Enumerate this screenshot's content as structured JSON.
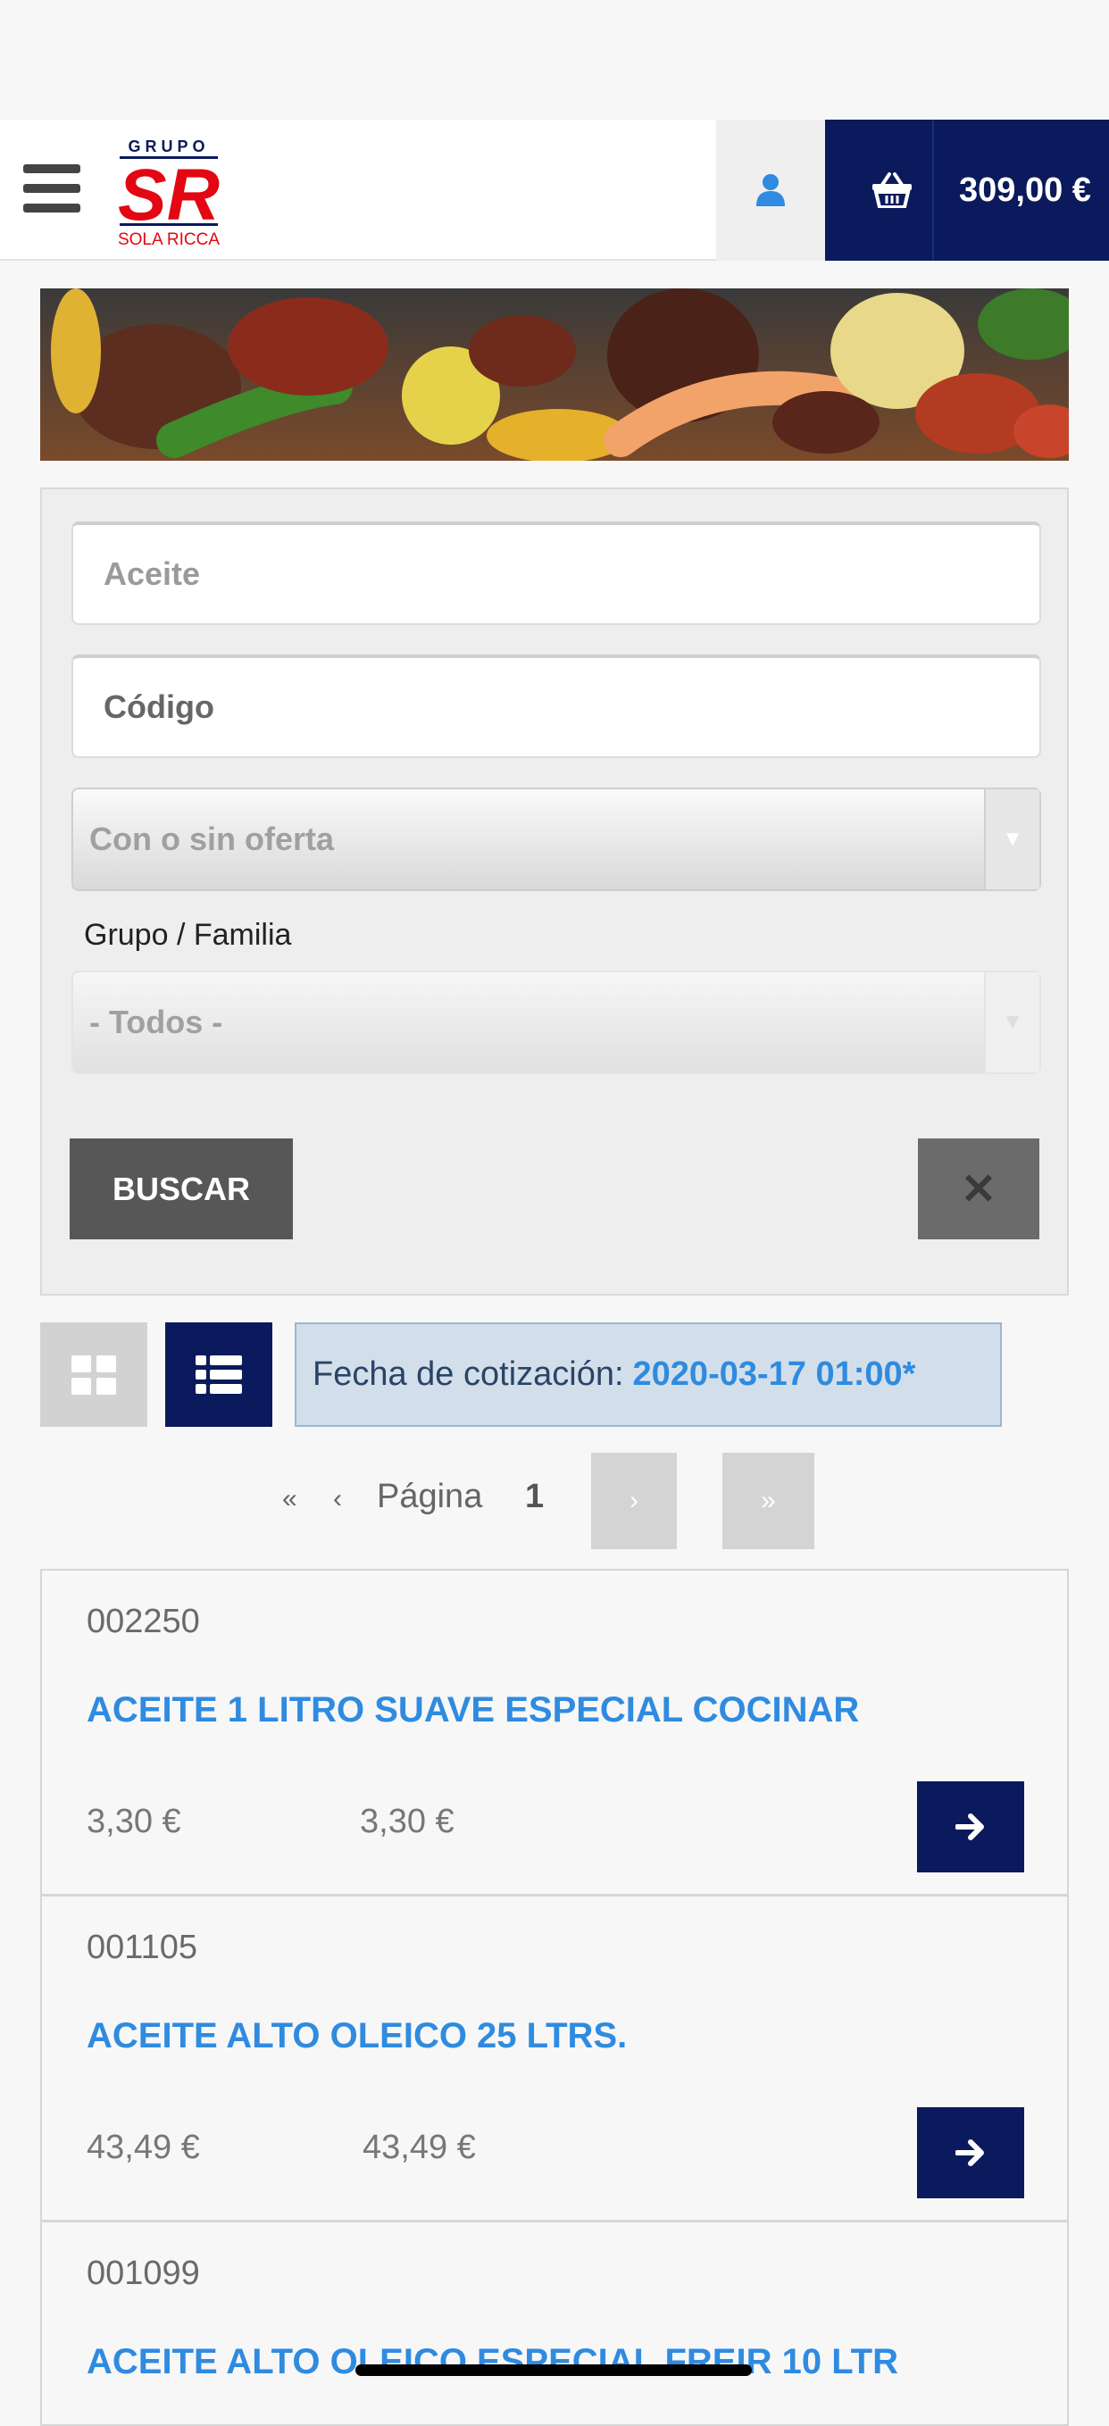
{
  "header": {
    "brand": {
      "top": "GRUPO",
      "mark": "SR",
      "bottom": "SOLA RICCA"
    },
    "cart_total": "309,00 €"
  },
  "search": {
    "query_value": "Aceite",
    "code_placeholder": "Código",
    "offer_select_value": "Con o sin oferta",
    "group_label": "Grupo / Familia",
    "group_select_value": "- Todos -",
    "search_button": "BUSCAR",
    "clear_button": "✕"
  },
  "quote": {
    "label": "Fecha de cotización:",
    "date": "2020-03-17 01:00*"
  },
  "pagination": {
    "first": "«",
    "prev": "‹",
    "label": "Página",
    "page": "1",
    "next": "›",
    "last": "»"
  },
  "products": [
    {
      "code": "002250",
      "name": "ACEITE 1 LITRO SUAVE ESPECIAL COCINAR",
      "price1": "3,30 €",
      "price2": "3,30 €"
    },
    {
      "code": "001105",
      "name": "ACEITE ALTO OLEICO 25 LTRS.",
      "price1": "43,49 €",
      "price2": "43,49 €"
    },
    {
      "code": "001099",
      "name": "ACEITE ALTO OLEICO ESPECIAL FREIR 10 LTR"
    }
  ],
  "colors": {
    "navy": "#0b1a5c",
    "link_blue": "#2f8be0",
    "brand_red": "#e30613"
  },
  "icons": [
    "menu-icon",
    "user-icon",
    "basket-icon",
    "grid-view-icon",
    "list-view-icon",
    "arrow-right-icon"
  ]
}
